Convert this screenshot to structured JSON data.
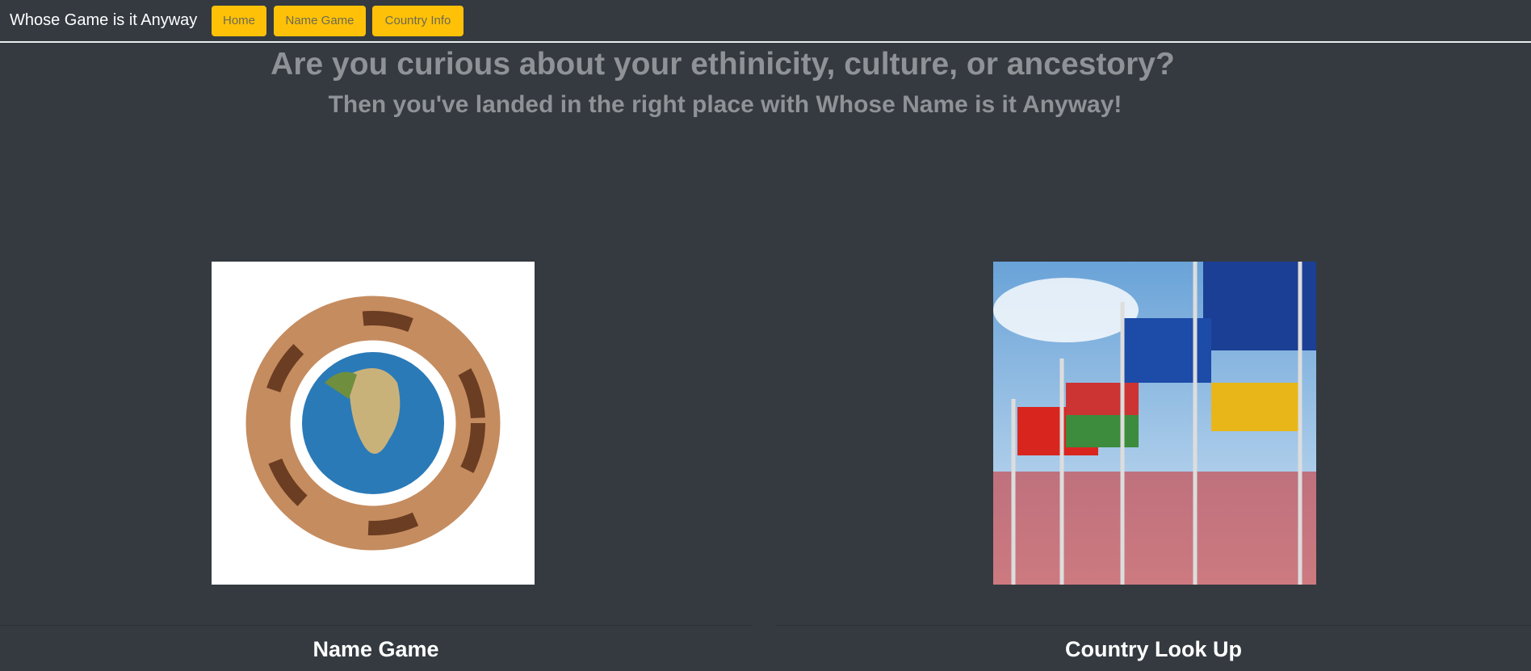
{
  "navbar": {
    "brand": "Whose Game is it Anyway",
    "links": [
      "Home",
      "Name Game",
      "Country Info"
    ]
  },
  "hero": {
    "title": "Are you curious about your ethinicity, culture, or ancestory?",
    "subtitle": "Then you've landed in the right place with Whose Name is it Anyway!"
  },
  "cards": [
    {
      "title": "Name Game",
      "image": "hands-around-globe"
    },
    {
      "title": "Country Look Up",
      "image": "world-flags"
    }
  ],
  "colors": {
    "background": "#343a40",
    "accent": "#ffc107"
  }
}
